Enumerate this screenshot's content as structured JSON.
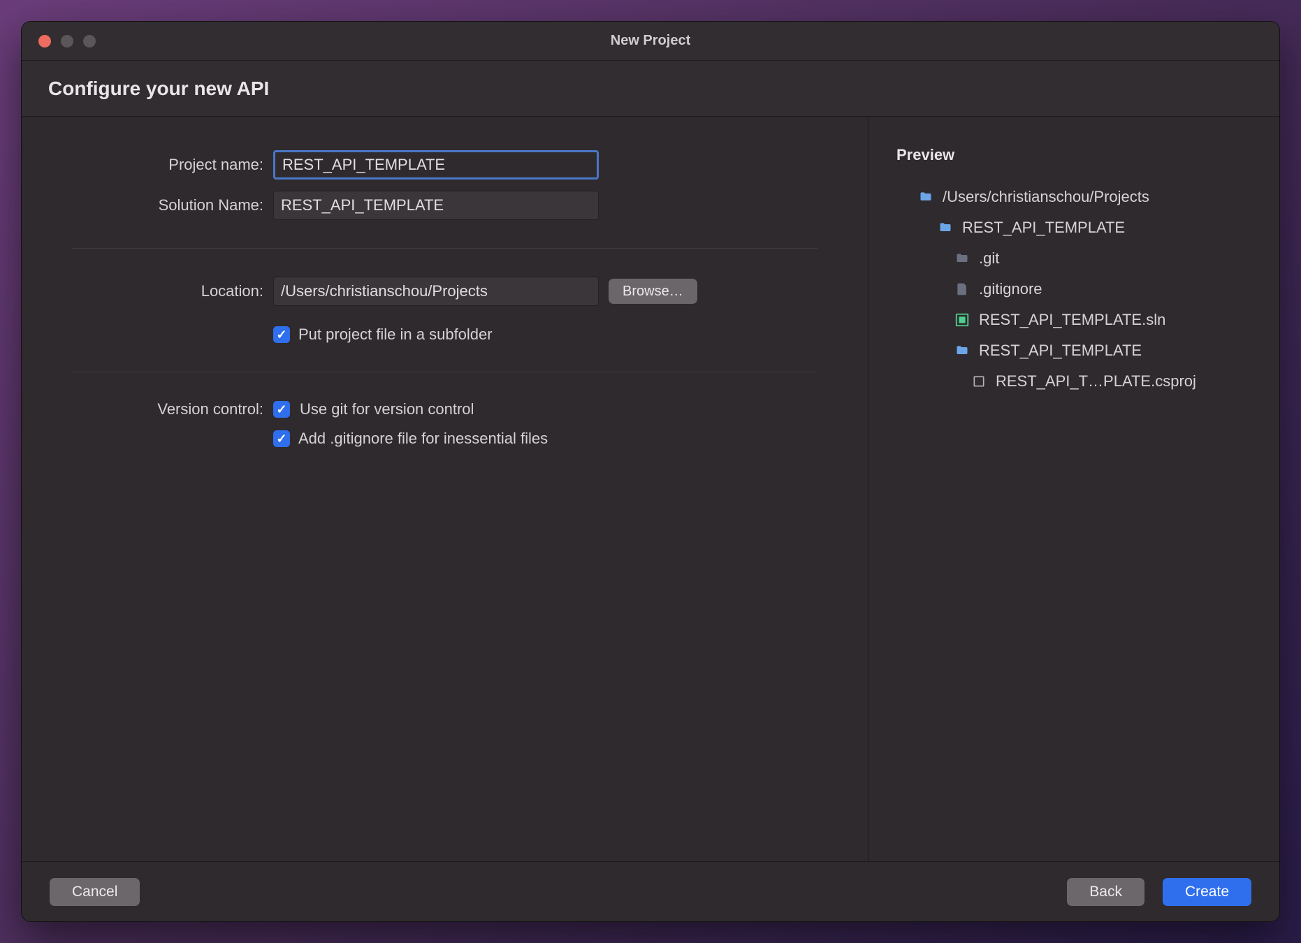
{
  "window": {
    "title": "New Project",
    "subtitle": "Configure your new API"
  },
  "form": {
    "project_name_label": "Project name:",
    "project_name_value": "REST_API_TEMPLATE",
    "solution_name_label": "Solution Name:",
    "solution_name_value": "REST_API_TEMPLATE",
    "location_label": "Location:",
    "location_value": "/Users/christianschou/Projects",
    "browse_label": "Browse…",
    "subfolder_label": "Put project file in a subfolder",
    "version_control_label": "Version control:",
    "use_git_label": "Use git for version control",
    "add_gitignore_label": "Add .gitignore file for inessential files"
  },
  "preview": {
    "title": "Preview",
    "tree": {
      "root": "/Users/christianschou/Projects",
      "project_folder": "REST_API_TEMPLATE",
      "git_folder": ".git",
      "gitignore_file": ".gitignore",
      "sln_file": "REST_API_TEMPLATE.sln",
      "inner_folder": "REST_API_TEMPLATE",
      "csproj_file": "REST_API_T…PLATE.csproj"
    }
  },
  "footer": {
    "cancel": "Cancel",
    "back": "Back",
    "create": "Create"
  }
}
